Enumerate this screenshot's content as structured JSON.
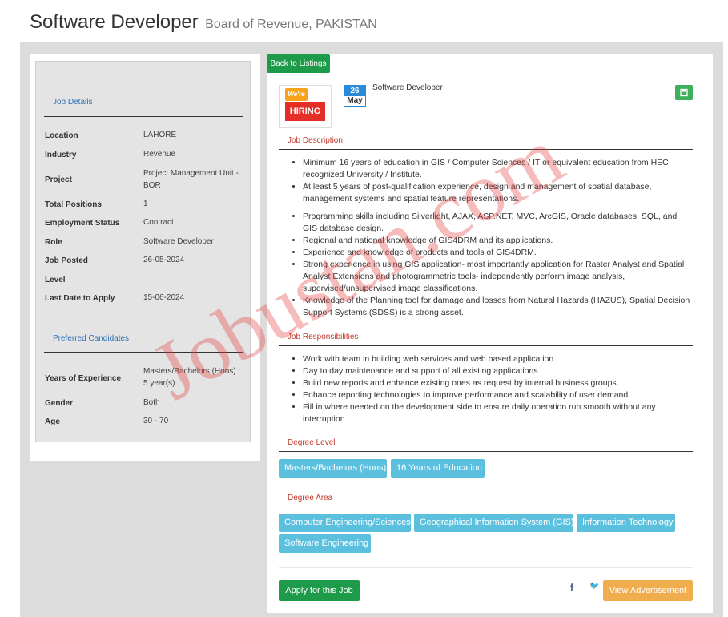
{
  "header": {
    "title": "Software Developer",
    "subtitle": "Board of Revenue, PAKISTAN"
  },
  "sidebar": {
    "job_details_title": "Job Details",
    "details": [
      {
        "label": "Location",
        "value": "LAHORE"
      },
      {
        "label": "Industry",
        "value": "Revenue"
      },
      {
        "label": "Project",
        "value": "Project Management Unit - BOR"
      },
      {
        "label": "Total Positions",
        "value": "1"
      },
      {
        "label": "Employment Status",
        "value": "Contract"
      },
      {
        "label": "Role",
        "value": "Software Developer"
      },
      {
        "label": "Job Posted",
        "value": "26-05-2024"
      },
      {
        "label": "Level",
        "value": ""
      },
      {
        "label": "Last Date to Apply",
        "value": "15-06-2024"
      }
    ],
    "preferred_title": "Preferred Candidates",
    "preferred": [
      {
        "label": "Years of Experience",
        "value": "Masters/Bachelors (Hons) : 5 year(s)"
      },
      {
        "label": "Gender",
        "value": "Both"
      },
      {
        "label": "Age",
        "value": "30 - 70"
      }
    ]
  },
  "main": {
    "back_label": "Back to Listings",
    "logo": {
      "bubble_text": "We're",
      "banner_text": "HIRING"
    },
    "date": {
      "day": "26",
      "month": "May"
    },
    "job_title": "Software Developer",
    "description_title": "Job Description",
    "description": [
      "Minimum 16 years of education in GIS / Computer Sciences / IT or equivalent education from HEC recognized University / Institute.",
      "At least 5 years of post-qualification experience, design and management of spatial database, management systems and spatial feature representations.",
      "Programming skills including Silverlight, AJAX, ASP.NET, MVC, ArcGIS, Oracle databases, SQL, and GIS database design.",
      "Regional and national knowledge of GIS4DRM and its applications.",
      "Experience and knowledge of products and tools of GIS4DRM.",
      "Strong experience in using GIS application- most importantly application for Raster Analyst and Spatial Analyst Extensions and photogrammetric tools- independently perform image analysis, supervised/unsupervised image classifications.",
      "Knowledge of the Planning tool for damage and losses from Natural Hazards (HAZUS), Spatial Decision Support Systems (SDSS) is a strong asset."
    ],
    "responsibilities_title": "Job Responsibilities",
    "responsibilities": [
      "Work with team in building web services and web based application.",
      "Day to day maintenance and support of all existing applications",
      "Build new reports and enhance existing ones as request by internal business groups.",
      "Enhance reporting technologies to improve performance and scalability of user demand.",
      "Fill in where needed on the development side to ensure daily operation run smooth without any interruption."
    ],
    "degree_level_title": "Degree Level",
    "degree_levels": [
      "Masters/Bachelors (Hons)",
      "16 Years of Education"
    ],
    "degree_area_title": "Degree Area",
    "degree_areas": [
      "Computer Engineering/Sciences",
      "Geographical Information System (GIS)",
      "Information Technology",
      "Software Engineering"
    ],
    "apply_label": "Apply for this Job",
    "social": {
      "facebook": "f",
      "twitter": "🐦"
    },
    "view_ad_label": "View Advertisement"
  },
  "watermark": "Jobustan.com",
  "colors": {
    "green": "#1e9b4a",
    "tag_blue": "#5bc0de",
    "section_red": "#c0392b",
    "link_blue": "#2e6fb0",
    "orange": "#f0ad4e"
  }
}
